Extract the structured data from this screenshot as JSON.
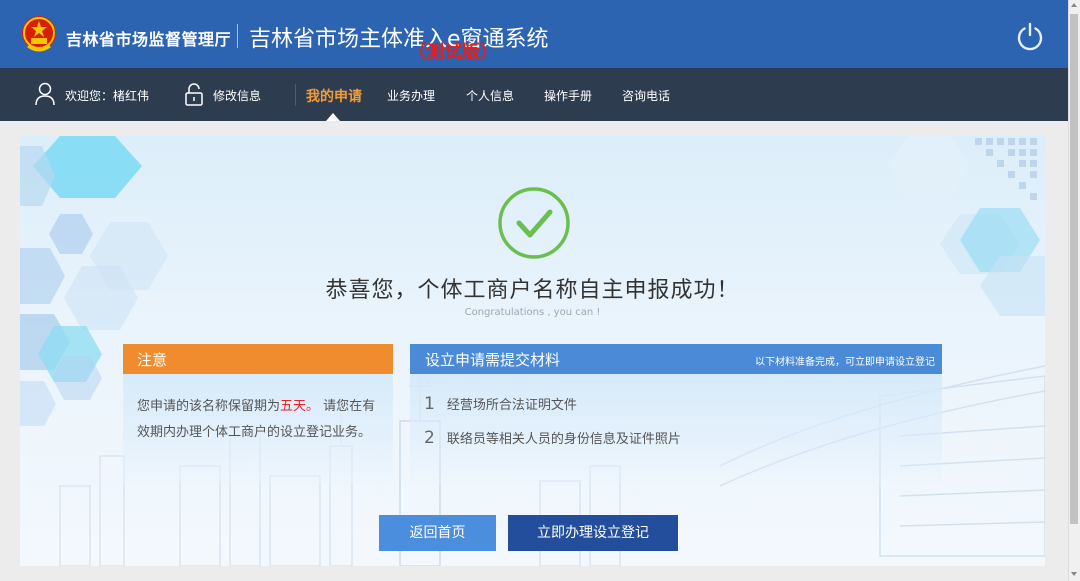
{
  "header": {
    "org_name": "吉林省市场监督管理厅",
    "system_title": "吉林省市场主体准入e窗通系统",
    "test_badge": "（测试版）",
    "power_icon": "power-icon",
    "emblem_icon": "national-emblem-icon"
  },
  "nav": {
    "welcome": "欢迎您：楮红伟",
    "user_icon": "user-icon",
    "edit_info": "修改信息",
    "lock_icon": "lock-icon",
    "items": [
      {
        "label": "我的申请",
        "active": true
      },
      {
        "label": "业务办理",
        "active": false
      },
      {
        "label": "个人信息",
        "active": false
      },
      {
        "label": "操作手册",
        "active": false
      },
      {
        "label": "咨询电话",
        "active": false
      }
    ]
  },
  "success": {
    "icon": "check-circle-icon",
    "title": "恭喜您，个体工商户名称自主申报成功！",
    "subtitle": "Congratulations , you can !"
  },
  "notice": {
    "title": "注意",
    "text_before": "您申请的该名称保留期为",
    "highlight": "五天。",
    "text_after": " 请您在有效期内办理个体工商户的设立登记业务。"
  },
  "materials": {
    "title": "设立申请需提交材料",
    "note": "以下材料准备完成，可立即申请设立登记",
    "items": [
      {
        "num": "1",
        "text": "经营场所合法证明文件"
      },
      {
        "num": "2",
        "text": "联络员等相关人员的身份信息及证件照片"
      }
    ]
  },
  "buttons": {
    "home": "返回首页",
    "register": "立即办理设立登记"
  },
  "colors": {
    "header_bg": "#2c64b1",
    "nav_bg": "#2e3c50",
    "nav_active": "#f39c37",
    "notice_orange": "#f08c2e",
    "materials_blue": "#4a8ad6",
    "success_green": "#6bbf4e",
    "highlight_red": "#e8232a",
    "primary_button": "#234e9b",
    "secondary_button": "#4b8edd"
  }
}
